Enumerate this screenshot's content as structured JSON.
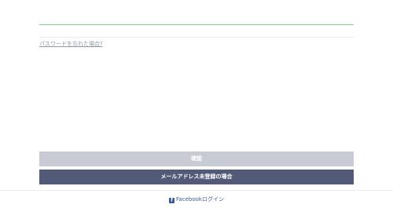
{
  "form": {
    "forgot_password": "パスワードを忘れた場合?",
    "confirm_button": "確認",
    "register_button": "メールアドレス未登録の場合"
  },
  "footer": {
    "facebook_icon_glyph": "f",
    "facebook_login": "Facebookログイン"
  }
}
